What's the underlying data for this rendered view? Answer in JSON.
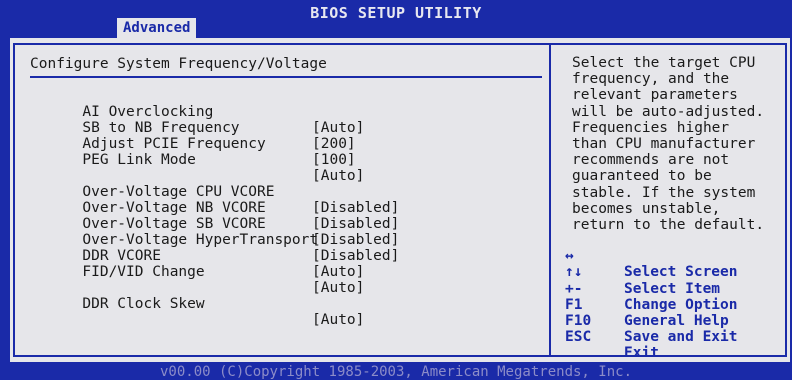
{
  "title_bar": {
    "title": "BIOS SETUP UTILITY",
    "active_tab": "Advanced"
  },
  "main": {
    "section_title": "Configure System Frequency/Voltage",
    "items": [
      {
        "label": "AI Overclocking",
        "value": "[Auto]"
      },
      {
        "label": "SB to NB Frequency",
        "value": "[200]"
      },
      {
        "label": "Adjust PCIE Frequency",
        "value": "[100]"
      },
      {
        "label": "PEG Link Mode",
        "value": "[Auto]"
      },
      {
        "label": "Over-Voltage CPU VCORE",
        "value": "[Disabled]"
      },
      {
        "label": "Over-Voltage NB VCORE",
        "value": "[Disabled]"
      },
      {
        "label": "Over-Voltage SB VCORE",
        "value": "[Disabled]"
      },
      {
        "label": "Over-Voltage HyperTransport",
        "value": "[Disabled]"
      },
      {
        "label": "DDR VCORE",
        "value": "[Auto]"
      },
      {
        "label": "FID/VID Change",
        "value": "[Auto]"
      },
      {
        "label": "DDR Clock Skew",
        "value": "[Auto]"
      }
    ]
  },
  "help": {
    "lines": [
      "Select the target CPU",
      "frequency, and the",
      "relevant parameters",
      "will be auto-adjusted.",
      "Frequencies higher",
      "than CPU manufacturer",
      "recommends are not",
      "guaranteed to be",
      "stable. If the system",
      "becomes unstable,",
      "return to the default."
    ],
    "keys": [
      {
        "key": "↔",
        "desc": "Select Screen"
      },
      {
        "key": "↑↓",
        "desc": "Select Item"
      },
      {
        "key": "+-",
        "desc": "Change Option"
      },
      {
        "key": "F1",
        "desc": "General Help"
      },
      {
        "key": "F10",
        "desc": "Save and Exit"
      },
      {
        "key": "ESC",
        "desc": "Exit"
      }
    ]
  },
  "footer": {
    "text": "v00.00 (C)Copyright 1985-2003, American Megatrends, Inc."
  },
  "colors": {
    "background": "#1a2aa8",
    "panel": "#e6e6ea",
    "text": "#1a1a1a",
    "accent": "#1a2aa8"
  }
}
